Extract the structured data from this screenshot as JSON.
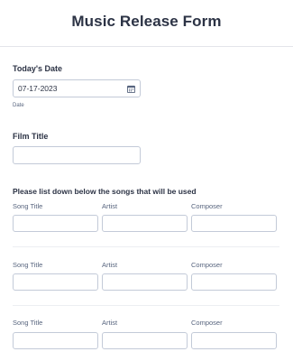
{
  "form": {
    "title": "Music Release Form"
  },
  "date_field": {
    "label": "Today's Date",
    "value": "07-17-2023",
    "sublabel": "Date",
    "icon": "calendar-icon"
  },
  "film_title": {
    "label": "Film Title",
    "value": ""
  },
  "songs": {
    "instruction": "Please list down below the songs that will be used",
    "columns": [
      "Song Title",
      "Artist",
      "Composer"
    ],
    "rows": [
      {
        "song_title": "",
        "artist": "",
        "composer": ""
      },
      {
        "song_title": "",
        "artist": "",
        "composer": ""
      },
      {
        "song_title": "",
        "artist": "",
        "composer": ""
      }
    ]
  }
}
